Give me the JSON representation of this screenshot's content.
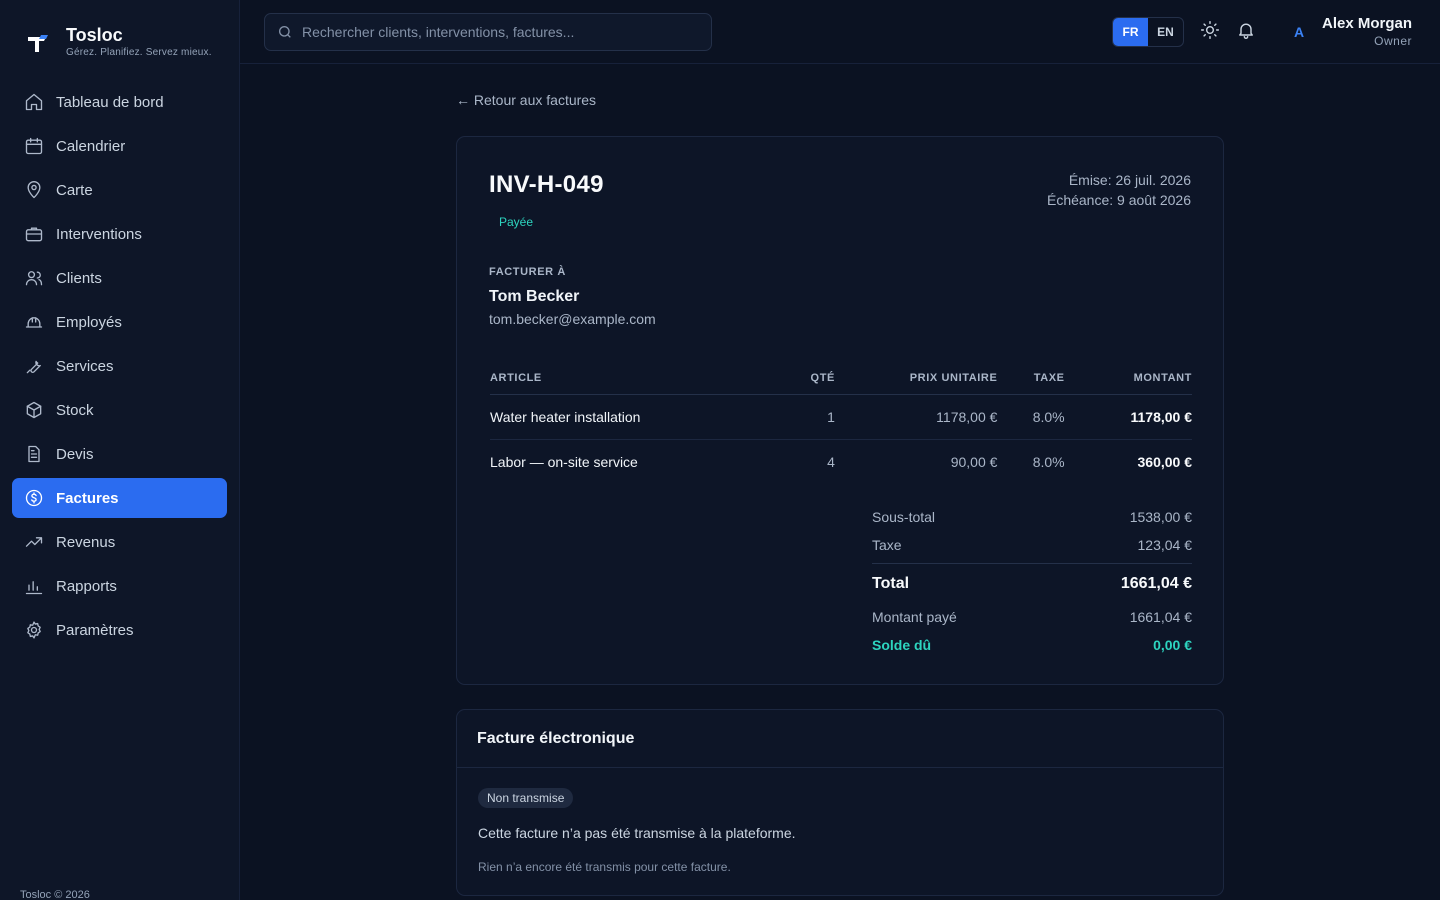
{
  "brand": {
    "name": "Tosloc",
    "tagline": "Gérez. Planifiez. Servez mieux."
  },
  "sidebar": {
    "items": [
      {
        "label": "Tableau de bord",
        "icon": "home-icon"
      },
      {
        "label": "Calendrier",
        "icon": "calendar-icon"
      },
      {
        "label": "Carte",
        "icon": "map-pin-icon"
      },
      {
        "label": "Interventions",
        "icon": "briefcase-icon"
      },
      {
        "label": "Clients",
        "icon": "users-icon"
      },
      {
        "label": "Employés",
        "icon": "hard-hat-icon"
      },
      {
        "label": "Services",
        "icon": "wrench-icon"
      },
      {
        "label": "Stock",
        "icon": "package-icon"
      },
      {
        "label": "Devis",
        "icon": "document-icon"
      },
      {
        "label": "Factures",
        "icon": "dollar-circle-icon",
        "active": true
      },
      {
        "label": "Revenus",
        "icon": "trending-up-icon"
      },
      {
        "label": "Rapports",
        "icon": "bar-chart-icon"
      },
      {
        "label": "Paramètres",
        "icon": "gear-icon"
      }
    ],
    "footer": "Tosloc © 2026"
  },
  "header": {
    "search_placeholder": "Rechercher clients, interventions, factures...",
    "lang": {
      "fr": "FR",
      "en": "EN",
      "selected": "FR"
    },
    "avatar_initial": "A",
    "user_name": "Alex Morgan",
    "user_role": "Owner"
  },
  "back_link": "← Retour aux factures",
  "invoice": {
    "number": "INV-H-049",
    "status": "Payée",
    "issued": "Émise: 26 juil. 2026",
    "due": "Échéance: 9 août 2026",
    "bill_to_label": "FACTURER À",
    "client_name": "Tom Becker",
    "client_email": "tom.becker@example.com",
    "columns": [
      "ARTICLE",
      "QTÉ",
      "PRIX UNITAIRE",
      "TAXE",
      "MONTANT"
    ],
    "items": [
      {
        "article": "Water heater installation",
        "qty": "1",
        "unit_price": "1178,00 €",
        "tax": "8.0%",
        "amount": "1178,00 €"
      },
      {
        "article": "Labor — on-site service",
        "qty": "4",
        "unit_price": "90,00 €",
        "tax": "8.0%",
        "amount": "360,00 €"
      }
    ],
    "totals": {
      "subtotal_label": "Sous-total",
      "subtotal": "1538,00 €",
      "tax_label": "Taxe",
      "tax": "123,04 €",
      "total_label": "Total",
      "total": "1661,04 €",
      "paid_label": "Montant payé",
      "paid": "1661,04 €",
      "balance_label": "Solde dû",
      "balance": "0,00 €"
    }
  },
  "einvoice": {
    "title": "Facture électronique",
    "badge": "Non transmise",
    "description": "Cette facture n’a pas été transmise à la plateforme.",
    "note": "Rien n’a encore été transmis pour cette facture."
  },
  "colors": {
    "accent": "#2b6cf0",
    "success": "#2dd4bf",
    "background": "#0b1222"
  }
}
